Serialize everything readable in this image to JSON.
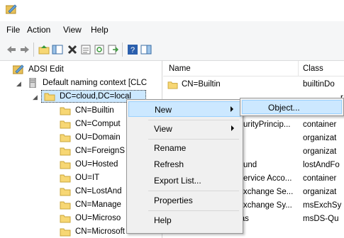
{
  "menubar": {
    "items": [
      "File",
      "Action",
      "View",
      "Help"
    ]
  },
  "tree": {
    "root": "ADSI Edit",
    "context": "Default naming context [CLC",
    "selected": "DC=cloud,DC=local",
    "children": [
      "CN=Builtin",
      "CN=Comput",
      "OU=Domain",
      "CN=ForeignS",
      "OU=Hosted",
      "OU=IT",
      "CN=LostAnd",
      "CN=Manage",
      "OU=Microso",
      "CN=Microsoft Exchai"
    ]
  },
  "list": {
    "columns": [
      "Name",
      "Class"
    ],
    "rows": [
      {
        "name": "CN=Builtin",
        "class": "builtinDo"
      },
      {
        "name": "",
        "class": "r"
      },
      {
        "name": "",
        "class": "r"
      },
      {
        "name": "urityPrincip...",
        "class": "container"
      },
      {
        "name": "",
        "class": "organizat"
      },
      {
        "name": "",
        "class": "organizat"
      },
      {
        "name": "und",
        "class": "lostAndFo"
      },
      {
        "name": "ervice Acco...",
        "class": "container"
      },
      {
        "name": "xchange Se...",
        "class": "organizat"
      },
      {
        "name": "xchange Sy...",
        "class": "msExchSy"
      },
      {
        "name": "CN=NTDS Quotas",
        "class": "msDS-Qu"
      }
    ]
  },
  "context_menu": {
    "items": [
      "New",
      "View",
      "Rename",
      "Refresh",
      "Export List...",
      "Properties",
      "Help"
    ]
  },
  "submenu": {
    "item": "Object..."
  },
  "colors": {
    "highlight": "#cce8ff",
    "highlight_border": "#99d1ff",
    "folder": "#f7d774"
  }
}
